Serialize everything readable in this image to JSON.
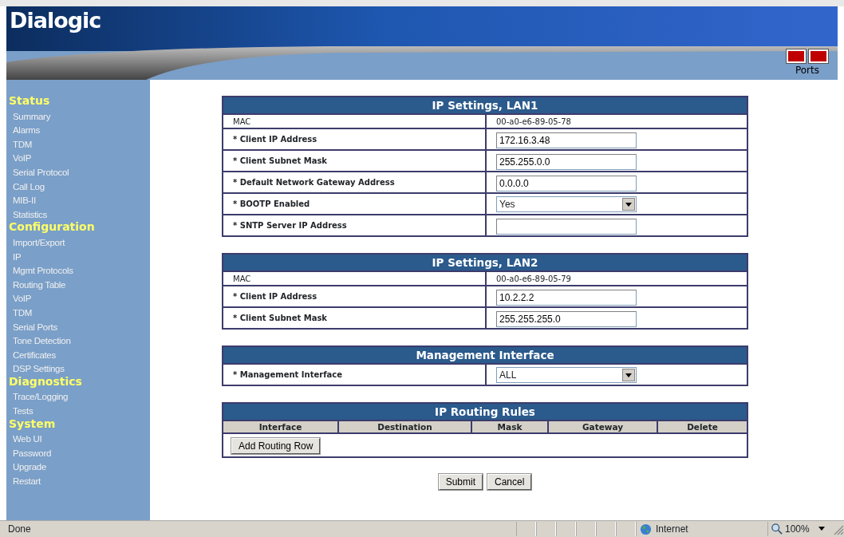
{
  "header": {
    "logo": "Dialogic",
    "ports_label": "Ports"
  },
  "sidebar": [
    {
      "title": "Status",
      "items": [
        "Summary",
        "Alarms",
        "TDM",
        "VoIP",
        "Serial Protocol",
        "Call Log",
        "MIB-II",
        "Statistics"
      ]
    },
    {
      "title": "Configuration",
      "items": [
        "Import/Export",
        "IP",
        "Mgmt Protocols",
        "Routing Table",
        "VoIP",
        "TDM",
        "Serial Ports",
        "Tone Detection",
        "Certificates",
        "DSP Settings"
      ]
    },
    {
      "title": "Diagnostics",
      "items": [
        "Trace/Logging",
        "Tests"
      ]
    },
    {
      "title": "System",
      "items": [
        "Web UI",
        "Password",
        "Upgrade",
        "Restart"
      ]
    }
  ],
  "sections": [
    {
      "kind": "form",
      "title": "IP Settings, LAN1",
      "rows": [
        {
          "kind": "text",
          "label": "MAC",
          "value": "00-a0-e6-89-05-78"
        },
        {
          "kind": "input",
          "label": "* Client IP Address",
          "value": "172.16.3.48"
        },
        {
          "kind": "input",
          "label": "* Client Subnet Mask",
          "value": "255.255.0.0"
        },
        {
          "kind": "input",
          "label": "* Default Network Gateway Address",
          "value": "0.0.0.0"
        },
        {
          "kind": "select",
          "label": "* BOOTP Enabled",
          "value": "Yes"
        },
        {
          "kind": "input",
          "label": "* SNTP Server IP Address"
        }
      ]
    },
    {
      "kind": "form",
      "title": "IP Settings, LAN2",
      "rows": [
        {
          "kind": "text",
          "label": "MAC",
          "value": "00-a0-e6-89-05-79"
        },
        {
          "kind": "input",
          "label": "* Client IP Address",
          "value": "10.2.2.2"
        },
        {
          "kind": "input",
          "label": "* Client Subnet Mask",
          "value": "255.255.255.0"
        }
      ]
    },
    {
      "kind": "form",
      "title": "Management Interface",
      "rows": [
        {
          "kind": "select",
          "label": "* Management Interface",
          "value": "ALL"
        }
      ]
    },
    {
      "kind": "table",
      "title": "IP Routing Rules",
      "columns": [
        "Interface",
        "Destination",
        "Mask",
        "Gateway",
        "Delete"
      ],
      "button": "Add Routing Row"
    }
  ],
  "buttons": [
    "Submit",
    "Cancel"
  ],
  "status_bar": {
    "text": "Done",
    "zone": "Internet",
    "zoom": "100%"
  }
}
